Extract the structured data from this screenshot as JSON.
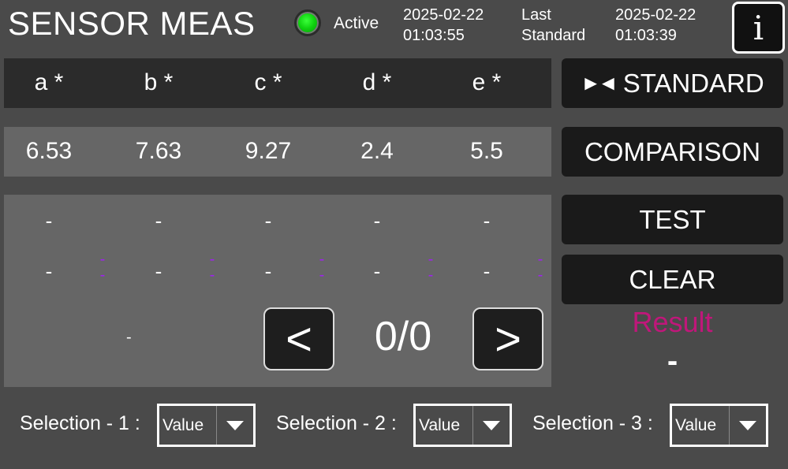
{
  "header": {
    "title": "SENSOR MEAS",
    "status": "Active",
    "current_timestamp_date": "2025-02-22",
    "current_timestamp_time": "01:03:55",
    "last_standard_label_line1": "Last",
    "last_standard_label_line2": "Standard",
    "last_standard_date": "2025-02-22",
    "last_standard_time": "01:03:39",
    "info_button": "i",
    "status_color": "#16d416"
  },
  "measurement": {
    "columns": [
      "a *",
      "b *",
      "c *",
      "d *",
      "e *"
    ],
    "values": [
      "6.53",
      "7.63",
      "9.27",
      "2.4",
      "5.5"
    ]
  },
  "results": {
    "row1": [
      "-",
      "-",
      "-",
      "-",
      "-"
    ],
    "row2": [
      "-",
      "-",
      "-",
      "-",
      "-"
    ],
    "diff_marks": [
      "-",
      "-",
      "-",
      "-",
      "-"
    ],
    "summary_dash": "-",
    "page_counter": "0/0",
    "prev_label": "<",
    "next_label": ">"
  },
  "actions": {
    "standard_icon": "►◄",
    "standard": "STANDARD",
    "comparison": "COMPARISON",
    "test": "TEST",
    "clear": "CLEAR"
  },
  "result": {
    "label": "Result",
    "value": "-",
    "label_color": "#c0177a"
  },
  "selections": [
    {
      "label": "Selection - 1 :",
      "value": "Value"
    },
    {
      "label": "Selection - 2 :",
      "value": "Value"
    },
    {
      "label": "Selection - 3 :",
      "value": "Value"
    }
  ],
  "icons": {
    "status_led": "green-led-icon",
    "dropdown": "triangle-down-icon",
    "prev": "chevron-left-icon",
    "next": "chevron-right-icon"
  }
}
